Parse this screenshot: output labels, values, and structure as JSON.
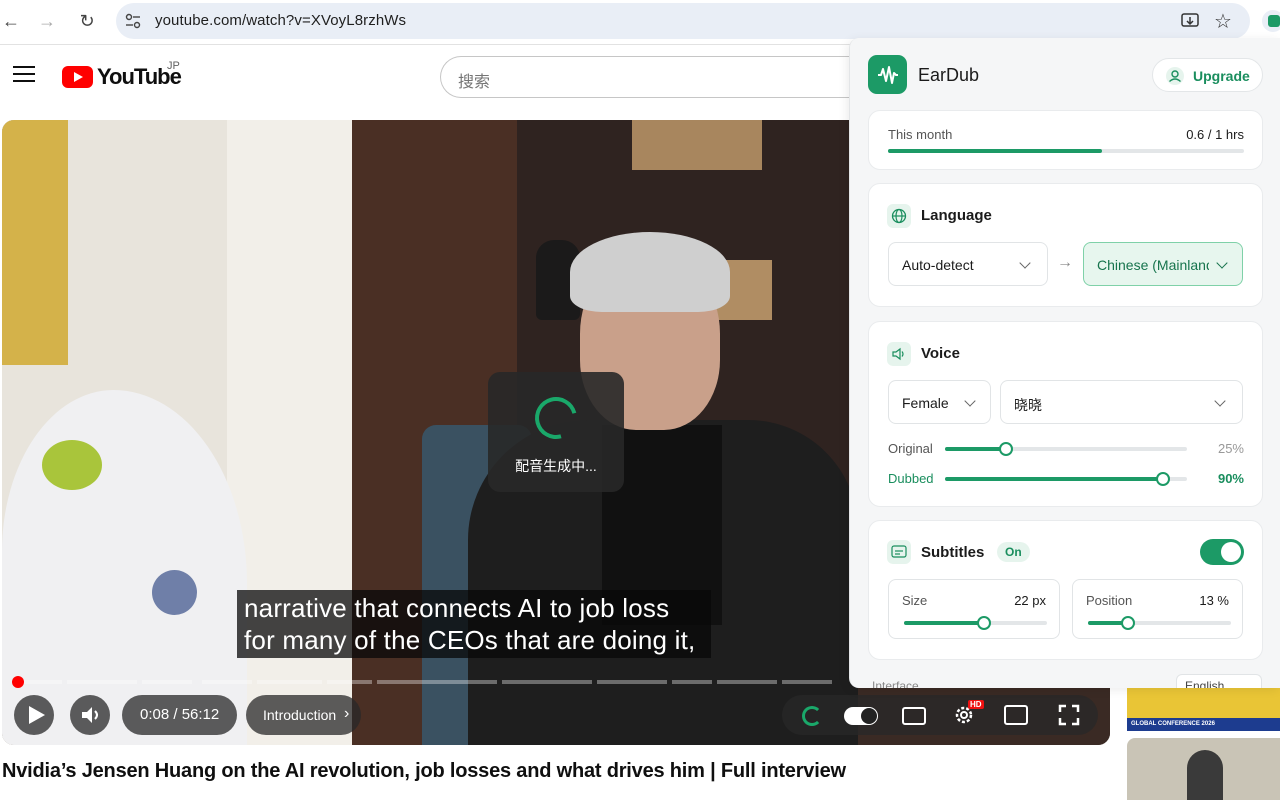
{
  "browser": {
    "url": "youtube.com/watch?v=XVoyL8rzhWs"
  },
  "youtube": {
    "logo_text": "YouTube",
    "region": "JP",
    "search_placeholder": "搜索"
  },
  "video": {
    "subtitle_lines": [
      "narrative that connects AI to job loss",
      "for many of the CEOs that are doing it,"
    ],
    "loading_text": "配音生成中...",
    "time": "0:08 / 56:12",
    "chapter": "Introduction",
    "progress_fraction": 0.0024,
    "title": "Nvidia’s Jensen Huang on the AI revolution, job losses and what drives him | Full interview",
    "hd_badge": "HD"
  },
  "sidebar_thumbs": {
    "thumb1_text": "GLOBAL CONFERENCE 2026"
  },
  "panel": {
    "brand": "EarDub",
    "upgrade_label": "Upgrade",
    "usage": {
      "label": "This month",
      "value": "0.6 / 1 hrs",
      "fraction": 0.6
    },
    "language": {
      "title": "Language",
      "source": "Auto-detect",
      "target": "Chinese (Mainland)"
    },
    "voice": {
      "title": "Voice",
      "gender": "Female",
      "name": "晓晓",
      "original_label": "Original",
      "original_value": "25%",
      "original_level": 0.25,
      "dubbed_label": "Dubbed",
      "dubbed_value": "90%",
      "dubbed_level": 0.9
    },
    "subtitles": {
      "title": "Subtitles",
      "status": "On",
      "size_label": "Size",
      "size_value": "22 px",
      "position_label": "Position",
      "position_value": "13 %"
    },
    "interface": {
      "label": "Interface",
      "value": "English"
    }
  },
  "colors": {
    "accent": "#1c9a66",
    "youtube_red": "#ff0000"
  }
}
